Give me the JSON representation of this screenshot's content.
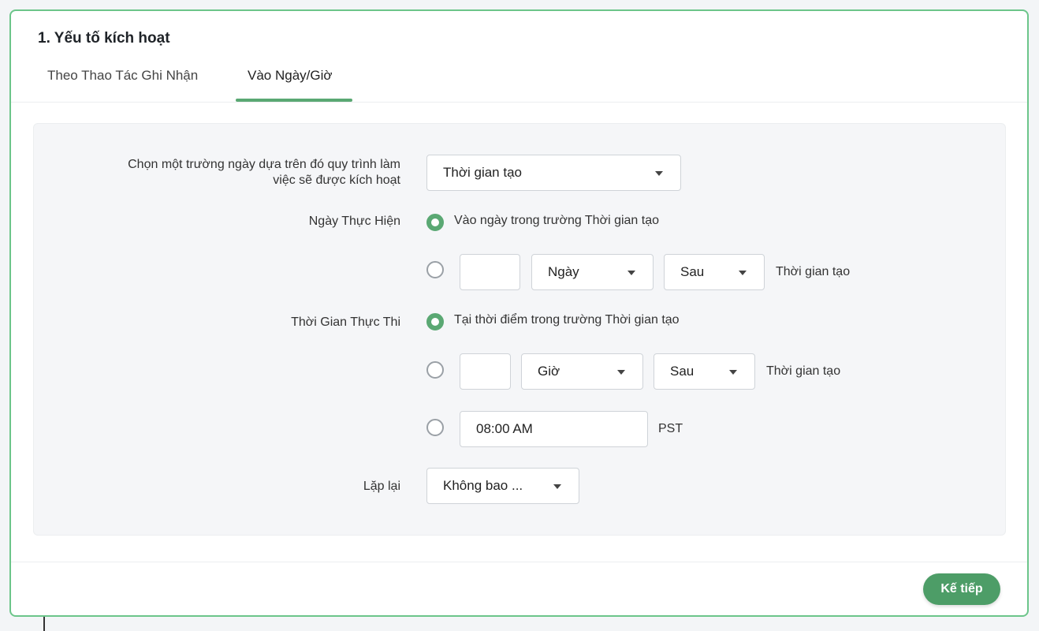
{
  "section": {
    "title": "1. Yếu tố kích hoạt"
  },
  "tabs": [
    {
      "label": "Theo Thao Tác Ghi Nhận",
      "active": false
    },
    {
      "label": "Vào Ngày/Giờ",
      "active": true
    }
  ],
  "form": {
    "date_field_label_line1": "Chọn một trường ngày dựa trên đó quy trình làm",
    "date_field_label_line2": "việc sẽ được kích hoạt",
    "date_field_value": "Thời gian tạo",
    "execution_date": {
      "label": "Ngày Thực Hiện",
      "option1_text": "Vào ngày trong trường Thời gian tạo",
      "option1_selected": true,
      "option2_selected": false,
      "offset_value": "",
      "unit_value": "Ngày",
      "direction_value": "Sau",
      "suffix": "Thời gian tạo"
    },
    "execution_time": {
      "label": "Thời Gian Thực Thi",
      "option1_text": "Tại thời điểm trong trường Thời gian tạo",
      "option1_selected": true,
      "option2_selected": false,
      "offset_value": "",
      "unit_value": "Giờ",
      "direction_value": "Sau",
      "suffix": "Thời gian tạo",
      "option3_selected": false,
      "time_value": "08:00 AM",
      "timezone": "PST"
    },
    "repeat": {
      "label": "Lặp lại",
      "value": "Không bao ..."
    }
  },
  "footer": {
    "next_label": "Kế tiếp"
  },
  "colors": {
    "accent": "#5aa873",
    "border": "#6cc58a",
    "button": "#4d9d67"
  }
}
